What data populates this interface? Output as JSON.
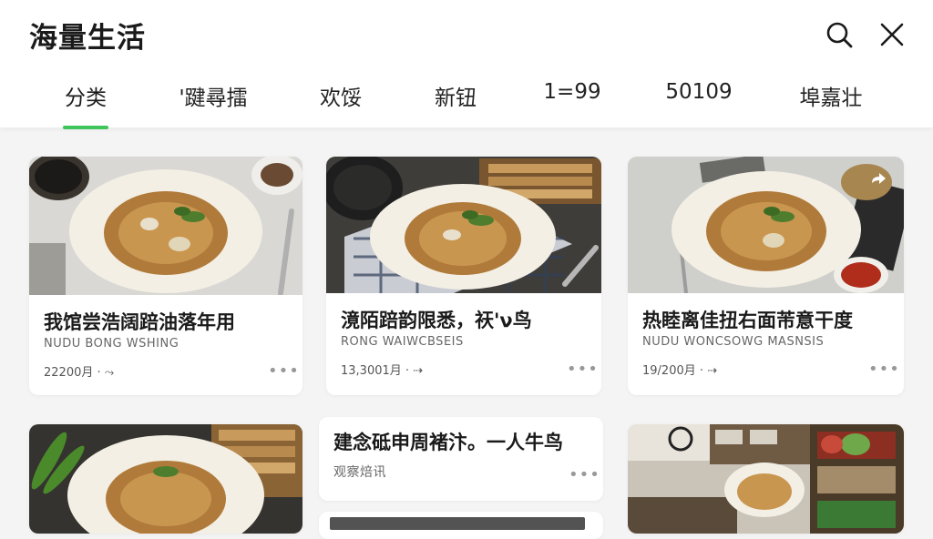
{
  "header": {
    "title": "海量生活",
    "search_icon": "search-icon",
    "close_icon": "close-icon"
  },
  "tabs": [
    {
      "label": "分类",
      "active": true
    },
    {
      "label": "'踺尋擂"
    },
    {
      "label": "欢馁"
    },
    {
      "label": "新钮"
    },
    {
      "label": "1=99"
    },
    {
      "label": "50109"
    },
    {
      "label": "埠嘉壮"
    }
  ],
  "accent_color": "#3ec65a",
  "cards": [
    {
      "title": "我馆尝浩阔踣油落年用",
      "subtitle": "NUDU BONG WSHING",
      "meta": "22200月 · ⤳"
    },
    {
      "title": "滰陌踣韵限悉，祆'ν鸟",
      "subtitle": "RONG WAIWCBSEIS",
      "meta": "13,3001月 · ⇢"
    },
    {
      "title": "热睦离佳扭右面芾意干度",
      "subtitle": "NUDU WONCSOWG MASNSIS",
      "meta": "19/200月 · ⇢"
    },
    {
      "title": "建念砥申周褚汴。一人牛鸟",
      "subtitle": "观察焙讯"
    },
    {
      "title": "",
      "subtitle": ""
    },
    {
      "title": "",
      "subtitle": ""
    }
  ],
  "more_label": "•••",
  "share_icon": "share-icon"
}
